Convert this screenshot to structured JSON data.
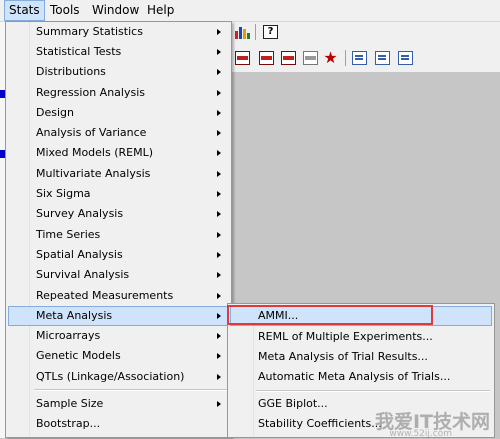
{
  "menubar": {
    "items": [
      {
        "label": "Stats",
        "active": true
      },
      {
        "label": "Tools"
      },
      {
        "label": "Window"
      },
      {
        "label": "Help"
      }
    ]
  },
  "toolbar": {
    "icons": [
      "bar-chart-icon",
      "help-icon",
      "red-spreadsheet-icon",
      "red-spreadsheet-icon",
      "red-spreadsheet-icon",
      "gray-spreadsheet-icon",
      "red-star-icon",
      "copy-doc-icon",
      "paste-doc-icon",
      "properties-icon"
    ],
    "help_glyph": "?",
    "star_glyph": "★"
  },
  "stats_menu": {
    "items": [
      {
        "label": "Summary Statistics",
        "submenu": true
      },
      {
        "label": "Statistical Tests",
        "submenu": true
      },
      {
        "label": "Distributions",
        "submenu": true
      },
      {
        "label": "Regression Analysis",
        "submenu": true
      },
      {
        "label": "Design",
        "submenu": true
      },
      {
        "label": "Analysis of Variance",
        "submenu": true
      },
      {
        "label": "Mixed Models (REML)",
        "submenu": true
      },
      {
        "label": "Multivariate Analysis",
        "submenu": true
      },
      {
        "label": "Six Sigma",
        "submenu": true
      },
      {
        "label": "Survey Analysis",
        "submenu": true
      },
      {
        "label": "Time Series",
        "submenu": true
      },
      {
        "label": "Spatial Analysis",
        "submenu": true
      },
      {
        "label": "Survival Analysis",
        "submenu": true
      },
      {
        "label": "Repeated Measurements",
        "submenu": true
      },
      {
        "label": "Meta Analysis",
        "submenu": true,
        "active": true
      },
      {
        "label": "Microarrays",
        "submenu": true
      },
      {
        "label": "Genetic Models",
        "submenu": true
      },
      {
        "label": "QTLs (Linkage/Association)",
        "submenu": true
      },
      {
        "label": "Sample Size",
        "submenu": true
      },
      {
        "label": "Bootstrap...",
        "submenu": false
      }
    ]
  },
  "meta_submenu": {
    "items": [
      {
        "label": "AMMI...",
        "active": true
      },
      {
        "label": "REML of Multiple Experiments..."
      },
      {
        "label": "Meta Analysis of Trial Results..."
      },
      {
        "label": "Automatic Meta Analysis of Trials..."
      },
      {
        "label": "GGE Biplot..."
      },
      {
        "label": "Stability Coefficients..."
      }
    ]
  },
  "colors": {
    "highlight_border": "#e0393a",
    "menu_hover_bg": "#cfe3fa",
    "menu_hover_border": "#84acdd"
  },
  "watermark": {
    "text": "我爱IT技术网",
    "sub": "www.52ij.com"
  }
}
